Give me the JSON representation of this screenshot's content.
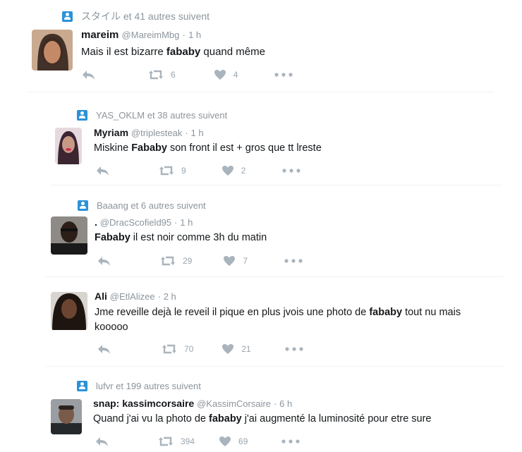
{
  "tweets": [
    {
      "context": "スタイル et 41 autres suivent",
      "name": "mareim",
      "handle": "@MareimMbg",
      "sep": "·",
      "time": "1 h",
      "text_before": "Mais il est bizarre ",
      "text_bold": "fababy",
      "text_after": " quand même",
      "retweets": "6",
      "likes": "4"
    },
    {
      "context": "YAS_OKLM et 38 autres suivent",
      "name": "Myriam",
      "handle": "@triplesteak",
      "sep": "·",
      "time": "1 h",
      "text_before": "Miskine ",
      "text_bold": "Fababy",
      "text_after": " son front il est + gros que tt lreste",
      "retweets": "9",
      "likes": "2"
    },
    {
      "context": "Baaang et 6 autres suivent",
      "name": ".",
      "handle": "@DracScofield95",
      "sep": "·",
      "time": "1 h",
      "text_before": "",
      "text_bold": "Fababy",
      "text_after": " il est noir comme 3h du matin",
      "retweets": "29",
      "likes": "7"
    },
    {
      "context": "",
      "name": "Ali",
      "handle": "@EtlAlizee",
      "sep": "·",
      "time": "2 h",
      "text_before": "Jme reveille dejà le reveil il pique en plus jvois une photo de ",
      "text_bold": "fababy",
      "text_after": " tout nu mais",
      "text_line2": "kooooo",
      "retweets": "70",
      "likes": "21"
    },
    {
      "context": "lufvr et 199 autres suivent",
      "name": "snap: kassimcorsaire",
      "handle": "@KassimCorsaire",
      "sep": "·",
      "time": "6 h",
      "text_before": "Quand j'ai vu la photo de ",
      "text_bold": "fababy",
      "text_after": " j'ai augmenté la luminosité pour etre sure",
      "retweets": "394",
      "likes": "69"
    }
  ],
  "icons": {
    "context": "follow-context-icon",
    "reply": "reply-icon",
    "retweet": "retweet-icon",
    "like": "heart-icon",
    "more": "more-dots-icon"
  },
  "colors": {
    "accent": "#2b92d9",
    "muted": "#8c959c",
    "action": "#aab4bc"
  }
}
